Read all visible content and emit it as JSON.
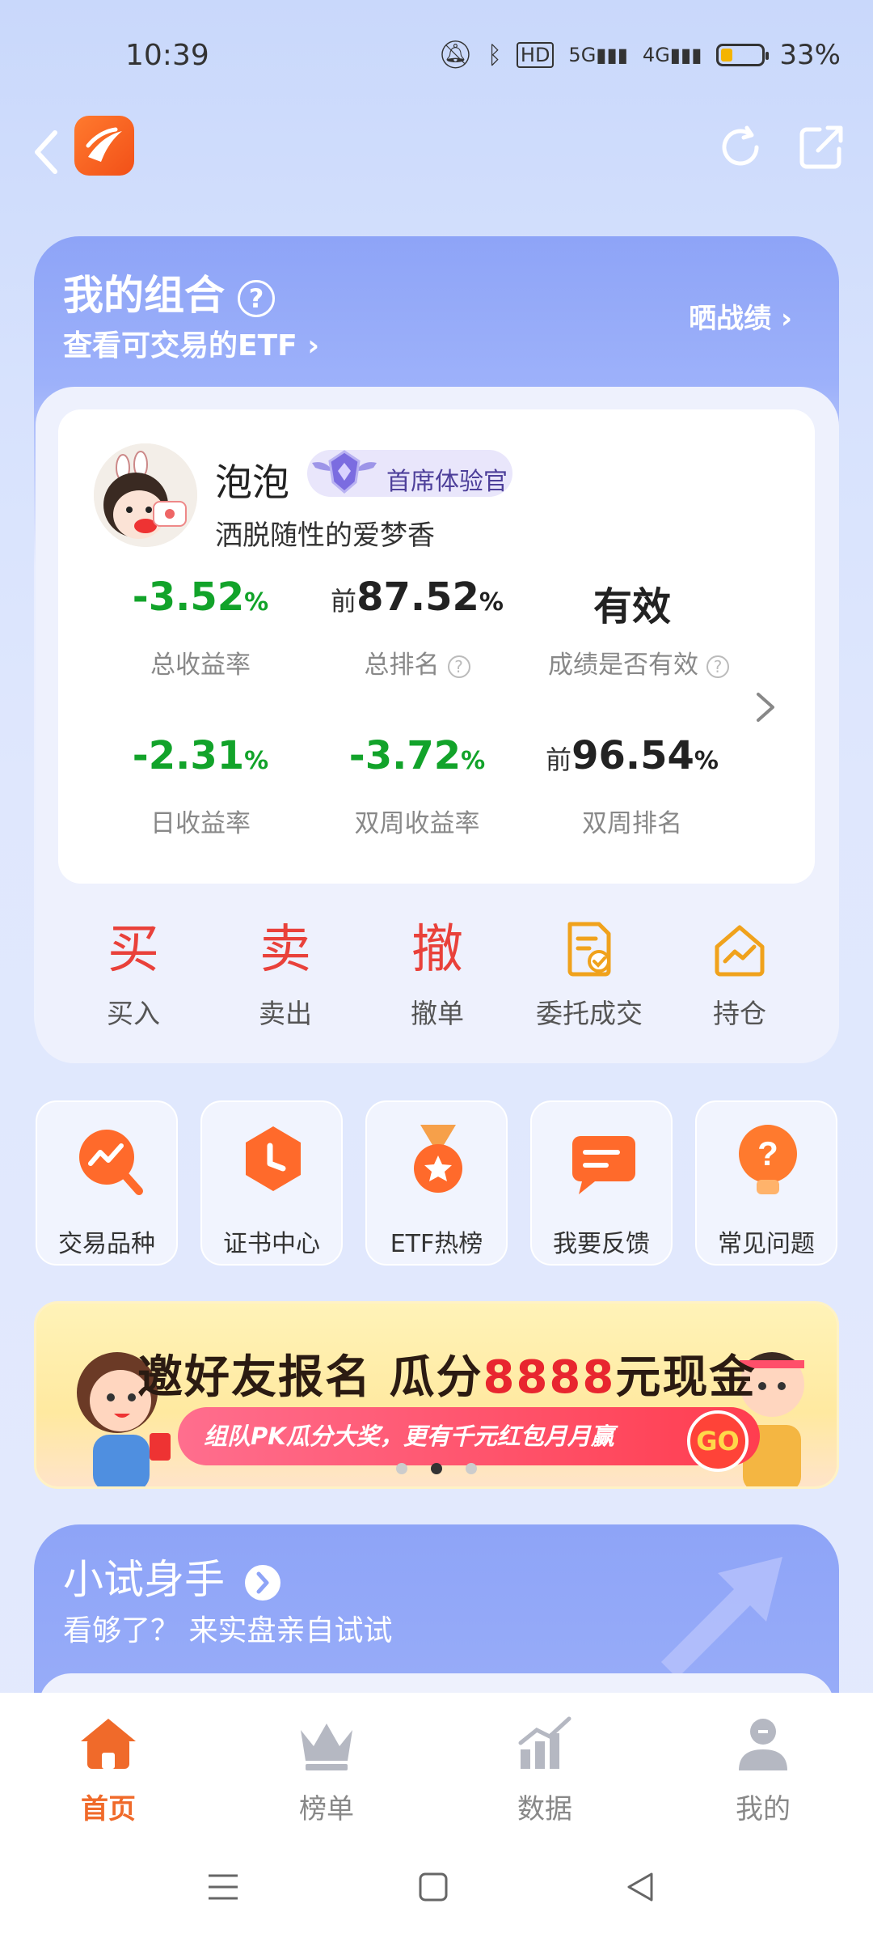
{
  "status_bar": {
    "time": "10:39",
    "battery": "33%",
    "network_1": "5G",
    "network_2": "4G",
    "hd": "HD"
  },
  "colors": {
    "accent": "#f25018",
    "green": "#12a32a",
    "red": "#e9413a",
    "card_blue": "#8ea4f7"
  },
  "portfolio": {
    "title": "我的组合",
    "help_icon": "?",
    "subtitle": "查看可交易的ETF",
    "show_record": "晒战绩",
    "user": {
      "name": "泡泡",
      "badge": "首席体验官",
      "signature": "洒脱随性的爱梦香"
    },
    "stats": [
      {
        "prefix": "",
        "value": "-3.52",
        "unit": "%",
        "label": "总收益率"
      },
      {
        "prefix": "前",
        "value": "87.52",
        "unit": "%",
        "label": "总排名"
      },
      {
        "prefix": "",
        "value": "有效",
        "unit": "",
        "label": "成绩是否有效"
      },
      {
        "prefix": "",
        "value": "-2.31",
        "unit": "%",
        "label": "日收益率"
      },
      {
        "prefix": "",
        "value": "-3.72",
        "unit": "%",
        "label": "双周收益率"
      },
      {
        "prefix": "前",
        "value": "96.54",
        "unit": "%",
        "label": "双周排名"
      }
    ],
    "actions": [
      {
        "glyph": "买",
        "label": "买入"
      },
      {
        "glyph": "卖",
        "label": "卖出"
      },
      {
        "glyph": "撤",
        "label": "撤单"
      },
      {
        "glyph": "document-check-icon",
        "label": "委托成交"
      },
      {
        "glyph": "house-chart-icon",
        "label": "持仓"
      }
    ]
  },
  "tiles": [
    {
      "icon": "trend-search-icon",
      "label": "交易品种"
    },
    {
      "icon": "clock-hexagon-icon",
      "label": "证书中心"
    },
    {
      "icon": "medal-star-icon",
      "label": "ETF热榜"
    },
    {
      "icon": "chat-bubble-icon",
      "label": "我要反馈"
    },
    {
      "icon": "question-bulb-icon",
      "label": "常见问题"
    }
  ],
  "banner": {
    "title_part1": "邀好友报名 瓜分",
    "title_amount": "8888",
    "title_part2": "元现金",
    "subtitle": "组队PK瓜分大奖，更有千元红包月月赢",
    "go": "GO",
    "page_index": 2,
    "page_count": 3
  },
  "try_section": {
    "title": "小试身手",
    "subtitle": "看够了？ 来实盘亲自试试"
  },
  "bottom_nav": [
    {
      "icon": "home-icon",
      "label": "首页",
      "active": true
    },
    {
      "icon": "crown-icon",
      "label": "榜单",
      "active": false
    },
    {
      "icon": "bar-chart-icon",
      "label": "数据",
      "active": false
    },
    {
      "icon": "user-icon",
      "label": "我的",
      "active": false
    }
  ]
}
